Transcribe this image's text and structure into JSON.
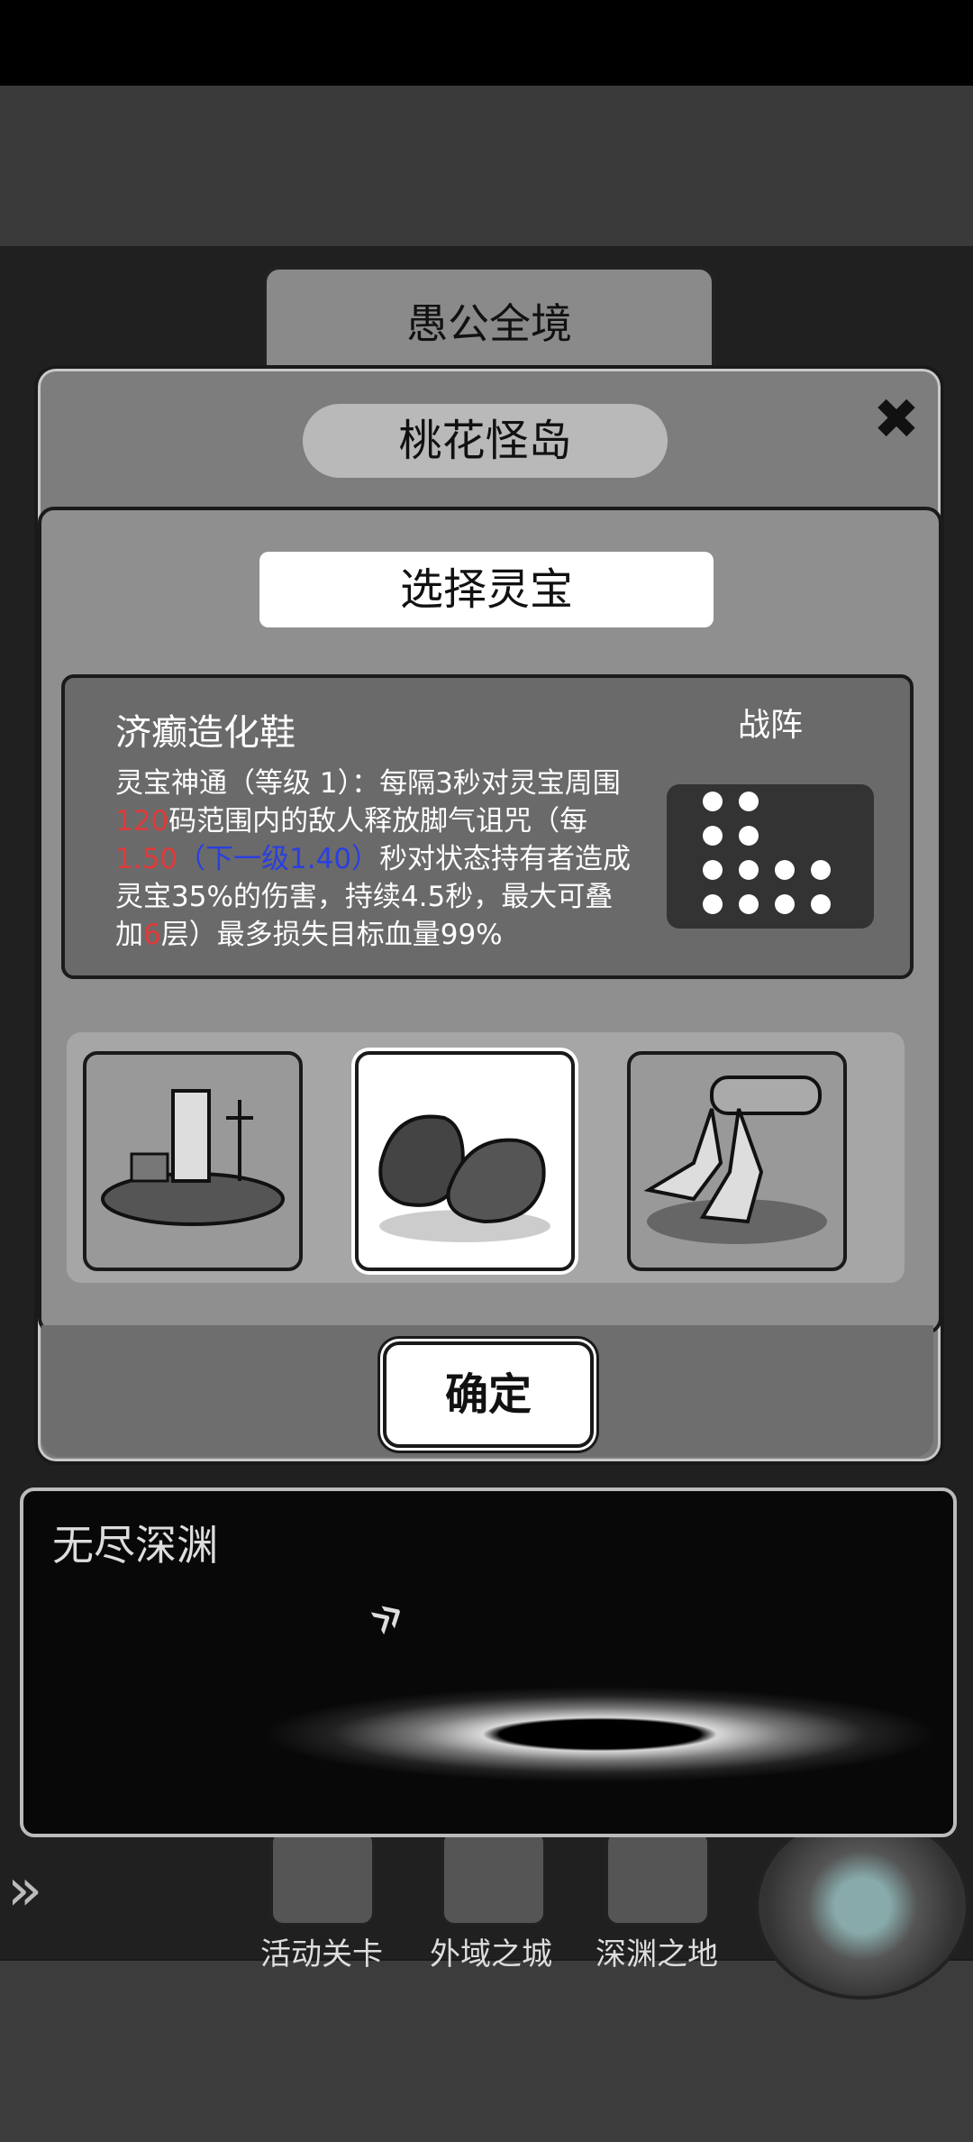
{
  "region_tab": {
    "label": "愚公全境"
  },
  "dialog": {
    "title": "桃花怪岛",
    "close_icon": "close-icon",
    "select_title": "选择灵宝",
    "item": {
      "name": "济癫造化鞋",
      "desc_1": "灵宝神通（等级 1）：每隔3秒对灵宝周围",
      "range_value": "120",
      "desc_2": "码范围内的敌人释放脚气诅咒（每",
      "interval_value": "1.50",
      "next_level_text": "（下一级1.40）",
      "desc_3": "秒对状态持有者造成灵宝35%的伤害，持续4.5秒，最大可叠加",
      "stack_value": "6",
      "desc_4": "层）最多损失目标血量99%"
    },
    "formation_label": "战阵",
    "slots": [
      {
        "icon": "ship-icon",
        "selected": false
      },
      {
        "icon": "shoes-icon",
        "selected": true
      },
      {
        "icon": "mech-legs-icon",
        "selected": false
      }
    ],
    "confirm_label": "确定"
  },
  "abyss": {
    "title": "无尽深渊",
    "arrow_icon": "double-chevron-icon"
  },
  "nav": {
    "items": [
      {
        "label": "活动关卡",
        "icon": "castle-icon"
      },
      {
        "label": "外域之城",
        "icon": "tower-icon"
      },
      {
        "label": "深渊之地",
        "icon": "well-icon"
      }
    ],
    "portal_icon": "portal-icon",
    "side_arrow_icon": "double-chevron-right-icon"
  }
}
